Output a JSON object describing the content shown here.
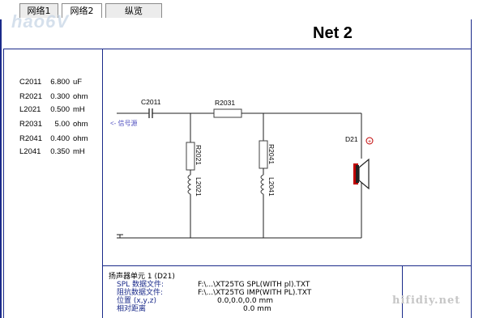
{
  "tabs": [
    {
      "label": "网络1",
      "active": false
    },
    {
      "label": "网络2",
      "active": true
    },
    {
      "label": "纵览",
      "active": false
    }
  ],
  "header": {
    "title": "Net 2"
  },
  "watermark": {
    "logo": "hao6V",
    "site": "hifidiy.net"
  },
  "components": [
    {
      "name": "C2011",
      "value": "6.800",
      "unit": "uF"
    },
    {
      "name": "R2021",
      "value": "0.300",
      "unit": "ohm"
    },
    {
      "name": "L2021",
      "value": "0.500",
      "unit": "mH"
    },
    {
      "name": "R2031",
      "value": "5.00",
      "unit": "ohm"
    },
    {
      "name": "R2041",
      "value": "0.400",
      "unit": "ohm"
    },
    {
      "name": "L2041",
      "value": "0.350",
      "unit": "mH"
    }
  ],
  "schematic": {
    "input_label": "<- 信号源",
    "labels": {
      "c2011": "C2011",
      "r2031": "R2031",
      "r2021": "R2021",
      "l2021": "L2021",
      "r2041": "R2041",
      "l2041": "L2041",
      "d21": "D21",
      "plus": "+"
    }
  },
  "driver_info": {
    "title": "扬声器单元 1 (D21)",
    "rows": [
      {
        "label": "SPL 数据文件:",
        "value": "F:\\...\\XT25TG SPL(WITH pl).TXT"
      },
      {
        "label": "阻抗数据文件:",
        "value": "F:\\...\\XT25TG IMP(WITH PL).TXT"
      },
      {
        "label": "位置 (x,y,z)",
        "value": "0.0,0.0,0.0 mm"
      },
      {
        "label": "相对距离",
        "value": "0.0 mm"
      }
    ]
  },
  "colors": {
    "frame": "#1a2a8a",
    "wire": "#1f1f1f",
    "component": "#404040",
    "input_label": "#5050c0",
    "speaker_red": "#c00000"
  }
}
